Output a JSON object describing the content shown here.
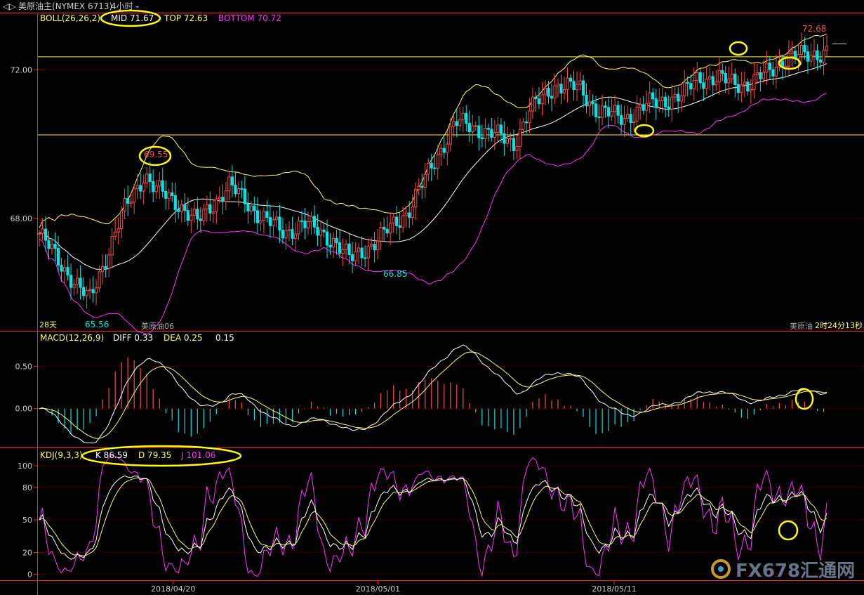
{
  "header": {
    "nav_glyph": "◁▷",
    "symbol": "美原油主(NYMEX 6713)",
    "period": "4小时",
    "period_glyph": "⌄"
  },
  "watermark": {
    "text": "FX678汇通网"
  },
  "colors": {
    "bg": "#000000",
    "up": "#ff4a4a",
    "down": "#00e5e5",
    "mid": "#ffffff",
    "top": "#ffff66",
    "bottom": "#ff33ff",
    "grid": "#8a0000",
    "axis": "#ff2222",
    "annot": "#ffff00",
    "k": "#ffffff",
    "d": "#ffff66",
    "j": "#ff33ff"
  },
  "price_panel": {
    "legend": {
      "boll": "BOLL(26,26,2)",
      "mid": "MID 71.67",
      "top": "TOP 72.63",
      "bottom": "BOTTOM 70.72"
    },
    "labels": {
      "high_recent": "72.68",
      "high_mid": "69.55",
      "low_mid": "66.85",
      "low_left": "65.56",
      "period_days": "28天",
      "contract_left": "美原油06",
      "contract_right": "美原油",
      "countdown": "2时24分13秒"
    }
  },
  "macd_panel": {
    "legend": {
      "macd": "MACD(12,26,9)",
      "diff": "DIFF 0.33",
      "dea": "DEA 0.25",
      "macd_val": "0.15"
    }
  },
  "kdj_panel": {
    "legend": {
      "kdj": "KDJ(9,3,3)",
      "k": "K 86.59",
      "d": "D 79.35",
      "j": "J 101.06"
    }
  },
  "chart_data": [
    {
      "type": "candlestick",
      "title": "",
      "y_ticks": [
        "72.00",
        "68.00"
      ],
      "ylim": [
        65.0,
        73.5
      ],
      "horizontal_lines": [
        72.35,
        70.25
      ],
      "x_ticks": [
        "2018/04/20",
        "2018/05/01",
        "2018/05/11"
      ],
      "key_points": {
        "open_first": 67.6,
        "close_last": 72.5,
        "high_max": 72.68,
        "low_min": 65.56,
        "notable_high": 69.55,
        "notable_low": 66.85
      },
      "bands": {
        "mid": "MID",
        "top": "TOP",
        "bottom": "BOTTOM"
      }
    },
    {
      "type": "bar",
      "title": "",
      "y_ticks": [
        "0.50",
        "0.00"
      ],
      "ylim": [
        -0.45,
        0.9
      ],
      "series": [
        {
          "name": "DIFF"
        },
        {
          "name": "DEA"
        }
      ]
    },
    {
      "type": "line",
      "title": "",
      "y_ticks": [
        "100",
        "80",
        "50",
        "20",
        "0"
      ],
      "ylim": [
        -5,
        115
      ],
      "series": [
        {
          "name": "K"
        },
        {
          "name": "D"
        },
        {
          "name": "J"
        }
      ]
    }
  ]
}
